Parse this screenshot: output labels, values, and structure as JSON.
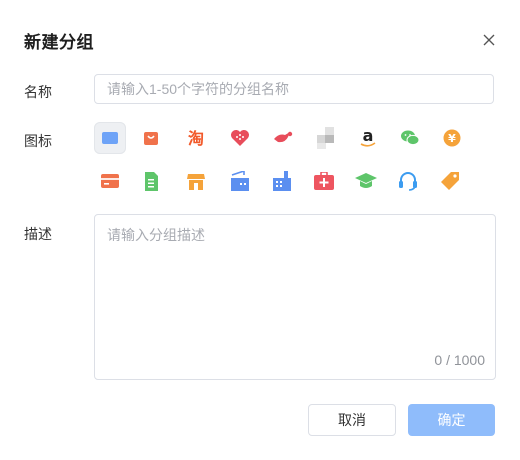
{
  "dialog": {
    "title": "新建分组",
    "close_icon": "close-icon"
  },
  "name_field": {
    "label": "名称",
    "value": "",
    "placeholder": "请输入1-50个字符的分组名称"
  },
  "icon_field": {
    "label": "图标",
    "selected_index": 0,
    "icons": [
      {
        "name": "folder-icon",
        "color": "#6ea3f7"
      },
      {
        "name": "shopping-bag-icon",
        "color": "#f0724b"
      },
      {
        "name": "taobao-icon",
        "color": "#f25a2b",
        "glyph": "淘"
      },
      {
        "name": "heart-icon",
        "color": "#e84d5b"
      },
      {
        "name": "bird-icon",
        "color": "#e84d5b"
      },
      {
        "name": "squares-icon",
        "color": "#c8c8c8"
      },
      {
        "name": "amazon-icon",
        "color": "#222222",
        "glyph": "a"
      },
      {
        "name": "wechat-icon",
        "color": "#5ec56a"
      },
      {
        "name": "yen-icon",
        "color": "#f5a33a",
        "glyph": "¥"
      },
      {
        "name": "card-icon",
        "color": "#f0724b"
      },
      {
        "name": "document-icon",
        "color": "#5ec56a"
      },
      {
        "name": "shop-icon",
        "color": "#f5a33a"
      },
      {
        "name": "building-icon",
        "color": "#5b8ff0"
      },
      {
        "name": "factory-icon",
        "color": "#5b8ff0"
      },
      {
        "name": "medical-kit-icon",
        "color": "#ee5560"
      },
      {
        "name": "graduation-cap-icon",
        "color": "#5ec56a"
      },
      {
        "name": "headset-icon",
        "color": "#3c9cf0"
      },
      {
        "name": "tag-icon",
        "color": "#f5a33a"
      }
    ]
  },
  "description_field": {
    "label": "描述",
    "value": "",
    "placeholder": "请输入分组描述",
    "counter": "0 / 1000"
  },
  "footer": {
    "cancel_label": "取消",
    "confirm_label": "确定"
  }
}
